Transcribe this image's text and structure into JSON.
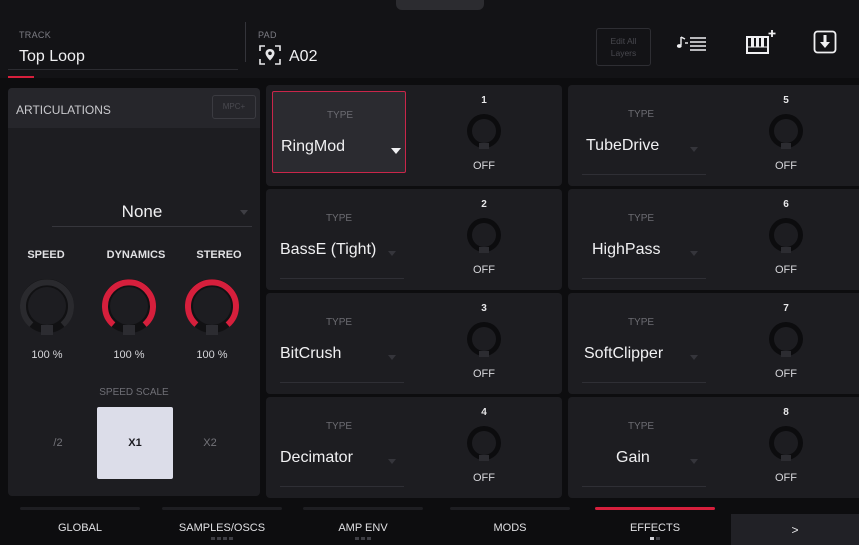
{
  "header": {
    "track_caption": "TRACK",
    "track_name": "Top Loop",
    "pad_caption": "PAD",
    "pad_name": "A02",
    "edit_all_line1": "Edit All",
    "edit_all_line2": "Layers",
    "icons": [
      "note-list-icon",
      "keyboard-add-icon",
      "save-download-icon"
    ]
  },
  "articulations": {
    "title": "ARTICULATIONS",
    "mpc_button": "MPC+",
    "value": "None",
    "knobs": [
      {
        "label": "SPEED",
        "value": "100 %",
        "level": 0
      },
      {
        "label": "DYNAMICS",
        "value": "100 %",
        "level": 1
      },
      {
        "label": "STEREO",
        "value": "100 %",
        "level": 1
      }
    ],
    "speed_scale_caption": "SPEED SCALE",
    "speed_scale_options": [
      "/2",
      "X1",
      "X2"
    ],
    "speed_scale_selected": "X1"
  },
  "effects": {
    "type_caption": "TYPE",
    "slots": [
      {
        "number": "1",
        "type": "RingMod",
        "value": "OFF",
        "selected": true
      },
      {
        "number": "2",
        "type": "BassE (Tight)",
        "value": "OFF",
        "selected": false
      },
      {
        "number": "3",
        "type": "BitCrush",
        "value": "OFF",
        "selected": false
      },
      {
        "number": "4",
        "type": "Decimator",
        "value": "OFF",
        "selected": false
      },
      {
        "number": "5",
        "type": "TubeDrive",
        "value": "OFF",
        "selected": false
      },
      {
        "number": "6",
        "type": "HighPass",
        "value": "OFF",
        "selected": false
      },
      {
        "number": "7",
        "type": "SoftClipper",
        "value": "OFF",
        "selected": false
      },
      {
        "number": "8",
        "type": "Gain",
        "value": "OFF",
        "selected": false
      }
    ]
  },
  "tabs": [
    {
      "label": "GLOBAL",
      "active": false
    },
    {
      "label": "SAMPLES/OSCS",
      "active": false
    },
    {
      "label": "AMP ENV",
      "active": false
    },
    {
      "label": "MODS",
      "active": false
    },
    {
      "label": "EFFECTS",
      "active": true
    },
    {
      "label": ">",
      "active": false
    }
  ],
  "colors": {
    "accent": "#d61f3c",
    "panel": "#1d1d21",
    "background": "#0d0d0f",
    "selected_button": "#dcdde9"
  }
}
